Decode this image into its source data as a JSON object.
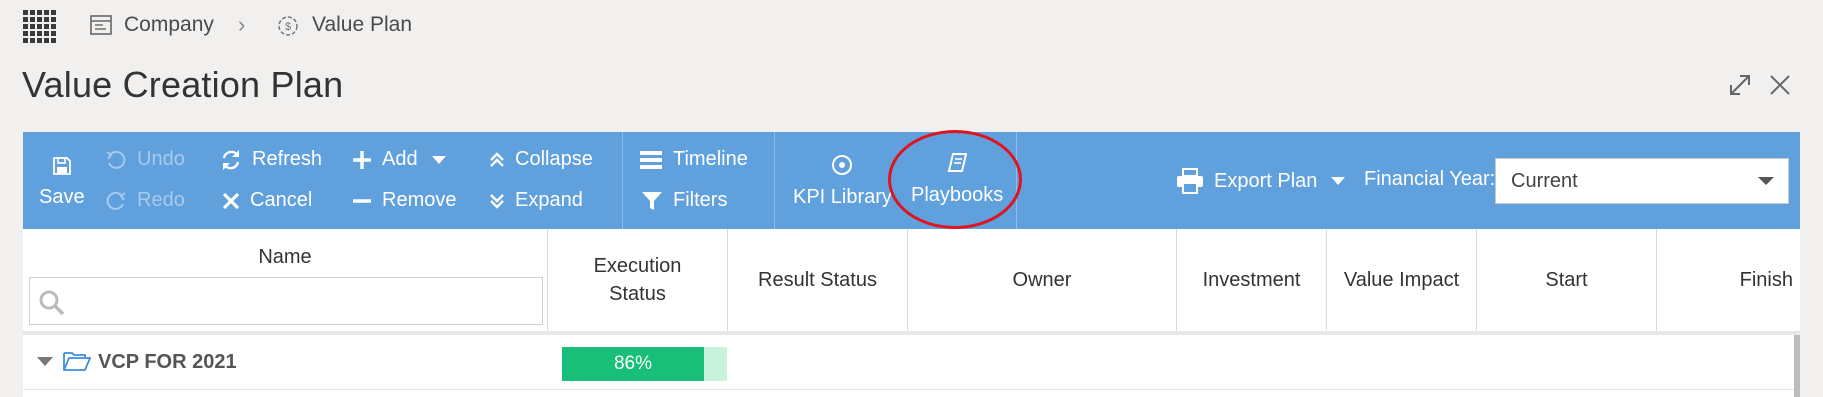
{
  "breadcrumb": {
    "company": "Company",
    "separator": "›",
    "plan": "Value Plan"
  },
  "page_title": "Value Creation Plan",
  "toolbar": {
    "save": "Save",
    "undo": "Undo",
    "redo": "Redo",
    "refresh": "Refresh",
    "cancel": "Cancel",
    "add": "Add",
    "remove": "Remove",
    "collapse": "Collapse",
    "expand": "Expand",
    "timeline": "Timeline",
    "filters": "Filters",
    "kpi_library": "KPI Library",
    "playbooks": "Playbooks",
    "export_plan": "Export Plan",
    "financial_year_label": "Financial Year:",
    "financial_year_value": "Current"
  },
  "grid": {
    "columns": {
      "name": "Name",
      "execution_status_line1": "Execution",
      "execution_status_line2": "Status",
      "result_status": "Result Status",
      "owner": "Owner",
      "investment": "Investment",
      "value_impact": "Value Impact",
      "start": "Start",
      "finish": "Finish"
    },
    "rows": [
      {
        "name": "VCP FOR 2021",
        "execution_progress": 0.86,
        "execution_label": "86%"
      }
    ]
  },
  "colors": {
    "toolbar_bg": "#5fa0dd",
    "progress_fill": "#17bf78",
    "annotation_circle": "#e0141e"
  }
}
